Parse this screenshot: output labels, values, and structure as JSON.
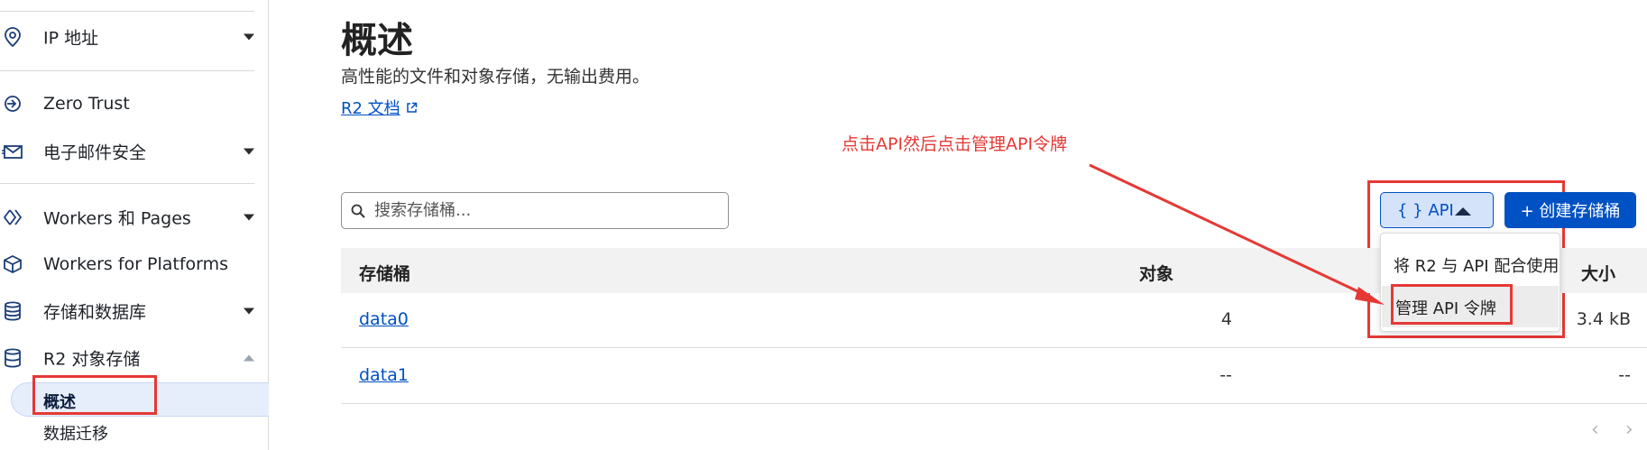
{
  "sidebar": {
    "items": [
      {
        "label": "IP 地址",
        "icon": "location-pin-icon",
        "expandable": true
      },
      {
        "label": "Zero Trust",
        "icon": "zero-trust-icon",
        "expandable": false
      },
      {
        "label": "电子邮件安全",
        "icon": "email-icon",
        "expandable": true
      },
      {
        "label": "Workers 和 Pages",
        "icon": "workers-icon",
        "expandable": true
      },
      {
        "label": "Workers for Platforms",
        "icon": "cube-icon",
        "expandable": false
      },
      {
        "label": "存储和数据库",
        "icon": "database-icon",
        "expandable": true
      },
      {
        "label": "R2 对象存储",
        "icon": "r2-storage-icon",
        "expanded": true
      }
    ],
    "sub_items": [
      {
        "label": "概述",
        "active": true
      },
      {
        "label": "数据迁移",
        "active": false
      }
    ]
  },
  "main": {
    "title": "概述",
    "description": "高性能的文件和对象存储，无输出费用。",
    "doc_link": "R2 文档",
    "search_placeholder": "搜索存储桶...",
    "api_button": "{ } API",
    "create_button": "+ 创建存储桶",
    "table": {
      "headers": {
        "bucket": "存储桶",
        "objects": "对象",
        "size": "大小"
      },
      "rows": [
        {
          "name": "data0",
          "objects": "4",
          "size": "3.4 kB"
        },
        {
          "name": "data1",
          "objects": "--",
          "size": "--"
        }
      ]
    }
  },
  "api_dropdown": {
    "items": [
      "将 R2 与 API 配合使用",
      "管理 API 令牌"
    ]
  },
  "annotation": {
    "text": "点击API然后点击管理API令牌",
    "color": "#e53935"
  },
  "colors": {
    "accent": "#0051c3",
    "annotation_red": "#e53935"
  }
}
